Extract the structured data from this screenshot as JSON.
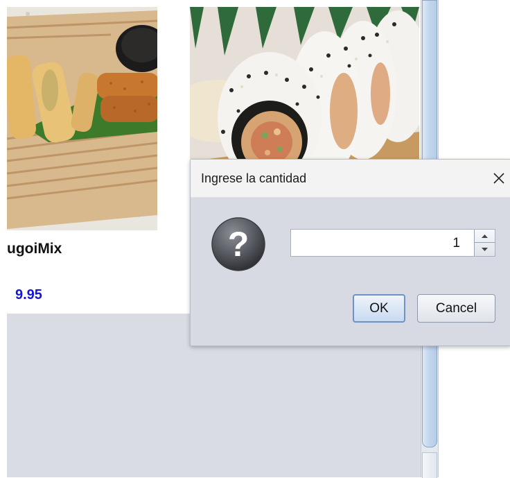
{
  "product": {
    "name": "ugoiMix",
    "price": "9.95"
  },
  "dialog": {
    "title": "Ingrese la cantidad",
    "quantity_value": "1",
    "ok_label": "OK",
    "cancel_label": "Cancel",
    "icons": {
      "close": "close-icon",
      "question": "question-icon",
      "spin_up": "chevron-up-icon",
      "spin_down": "chevron-down-icon"
    }
  },
  "colors": {
    "price": "#1515d6",
    "dialog_bg": "#d7dae2",
    "titlebar_bg": "#f3f3f3",
    "scrollbar_thumb": "#c4d7ee"
  }
}
